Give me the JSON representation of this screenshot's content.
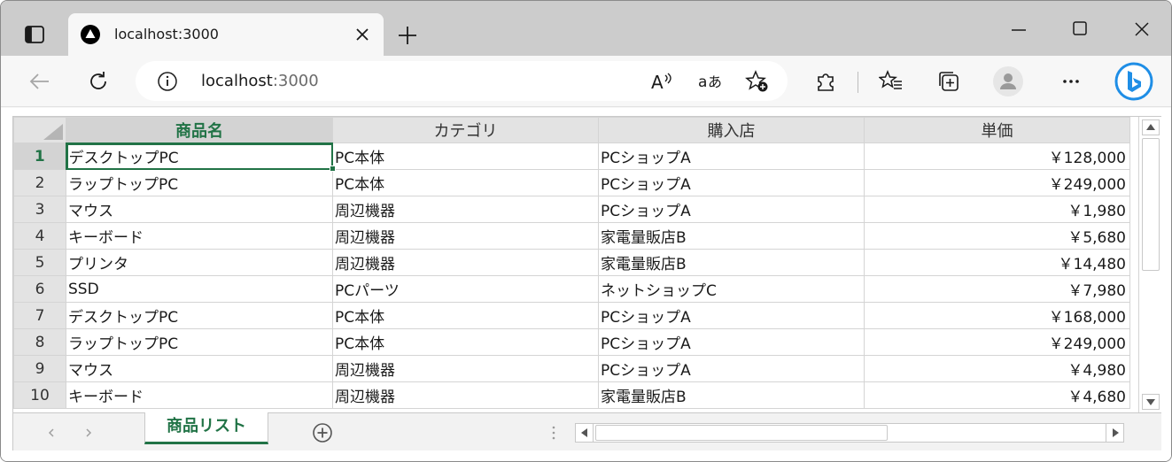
{
  "browser": {
    "tab": {
      "title": "localhost:3000"
    },
    "omnibox": {
      "host": "localhost",
      "port": ":3000"
    }
  },
  "sheet": {
    "columns": [
      "商品名",
      "カテゴリ",
      "購入店",
      "単価"
    ],
    "active_column": 0,
    "active_row": 1,
    "rows": [
      {
        "num": "1",
        "cells": [
          "デスクトップPC",
          "PC本体",
          "PCショップA",
          "￥128,000"
        ]
      },
      {
        "num": "2",
        "cells": [
          "ラップトップPC",
          "PC本体",
          "PCショップA",
          "￥249,000"
        ]
      },
      {
        "num": "3",
        "cells": [
          "マウス",
          "周辺機器",
          "PCショップA",
          "￥1,980"
        ]
      },
      {
        "num": "4",
        "cells": [
          "キーボード",
          "周辺機器",
          "家電量販店B",
          "￥5,680"
        ]
      },
      {
        "num": "5",
        "cells": [
          "プリンタ",
          "周辺機器",
          "家電量販店B",
          "￥14,480"
        ]
      },
      {
        "num": "6",
        "cells": [
          "SSD",
          "PCパーツ",
          "ネットショップC",
          "￥7,980"
        ]
      },
      {
        "num": "7",
        "cells": [
          "デスクトップPC",
          "PC本体",
          "PCショップA",
          "￥168,000"
        ]
      },
      {
        "num": "8",
        "cells": [
          "ラップトップPC",
          "PC本体",
          "PCショップA",
          "￥249,000"
        ]
      },
      {
        "num": "9",
        "cells": [
          "マウス",
          "周辺機器",
          "PCショップA",
          "￥4,980"
        ]
      },
      {
        "num": "10",
        "cells": [
          "キーボード",
          "周辺機器",
          "家電量販店B",
          "￥4,680"
        ]
      }
    ],
    "tabs": [
      {
        "label": "商品リスト",
        "active": true
      }
    ]
  },
  "icons": {
    "tab_actions": "tab-actions-icon",
    "favicon": "nextjs-triangle-icon",
    "tab_close": "close-icon",
    "new_tab": "plus-icon",
    "back": "arrow-left-icon",
    "refresh": "refresh-icon",
    "site_info": "info-icon",
    "read_aloud": "read-aloud-icon",
    "translate": "translate-icon",
    "favorite_add": "star-plus-icon",
    "extensions": "puzzle-icon",
    "favorites": "favorites-list-icon",
    "collections": "collections-icon",
    "profile": "person-icon",
    "more": "ellipsis-icon",
    "copilot": "bing-copilot-icon"
  },
  "colors": {
    "accent_green": "#217346",
    "tabstrip": "#cccccc",
    "toolbar": "#f7f7f7",
    "header_bg": "#e3e3e3"
  }
}
